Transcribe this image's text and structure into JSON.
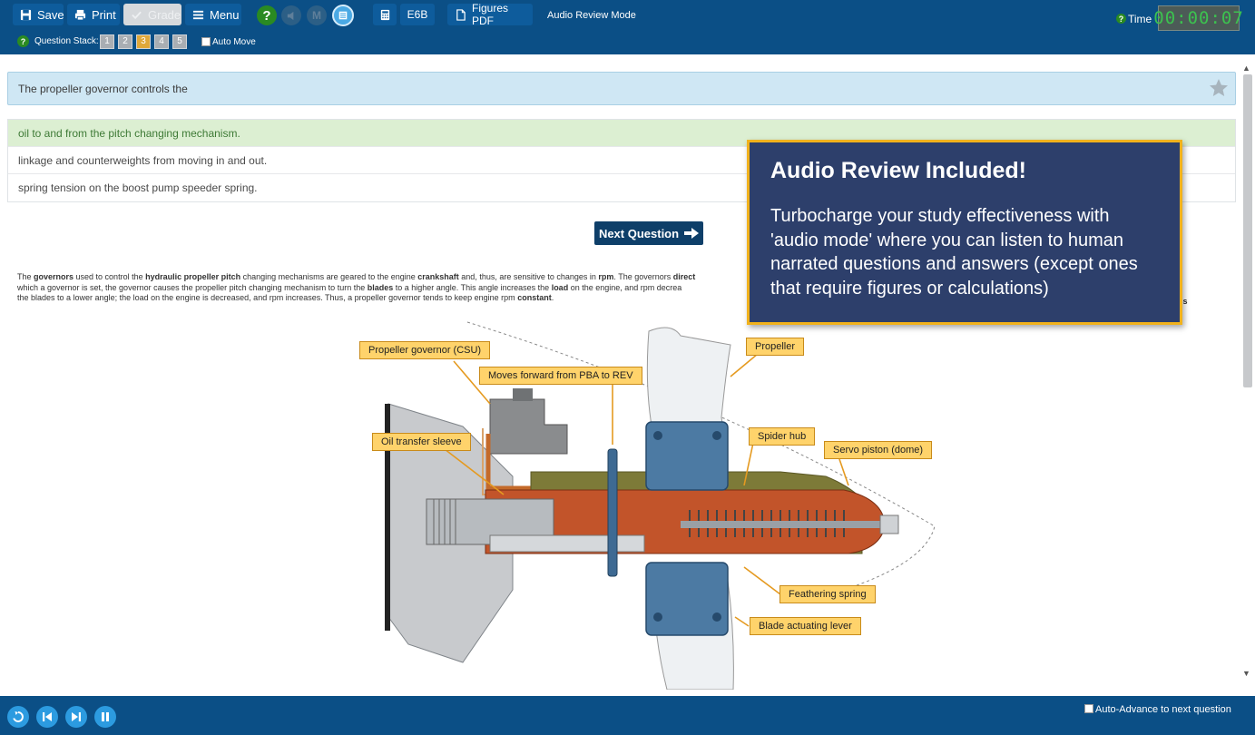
{
  "toolbar": {
    "save_label": "Save",
    "print_label": "Print",
    "grade_label": "Grade",
    "menu_label": "Menu",
    "help_glyph": "?",
    "markdown_glyph": "M",
    "code_label": "E6B",
    "figures_label": "Figures PDF",
    "mode_label": "Audio Review Mode",
    "time_label": "Time",
    "time_value": "00:00:07",
    "question_stack_label": "Question Stack:",
    "stack_items": [
      "1",
      "2",
      "3",
      "4",
      "5"
    ],
    "stack_active_index": 2,
    "auto_move_label": "Auto Move"
  },
  "question": {
    "text": "The propeller governor controls the",
    "answers": [
      "oil to and from the pitch changing mechanism.",
      "linkage and counterweights from moving in and out.",
      "spring tension on the boost pump speeder spring."
    ],
    "correct_index": 0
  },
  "next_button_label": "Next Question",
  "explanation": {
    "line1_a": "The ",
    "line1_b": "governors",
    "line1_c": " used to control the ",
    "line1_d": "hydraulic propeller pitch",
    "line1_e": " changing mechanisms are geared to the engine ",
    "line1_f": "crankshaft",
    "line1_g": " and, thus, are sensitive to changes in ",
    "line1_h": "rpm",
    "line1_i": ". The governors ",
    "line1_j": "direct",
    "line2_a": "which a governor is set, the governor causes the propeller pitch changing mechanism to turn the ",
    "line2_b": "blades",
    "line2_c": " to a higher angle. This angle increases the ",
    "line2_d": "load",
    "line2_e": " on the engine, and rpm decrea",
    "line3_a": "the blades to a lower angle; the load on the engine is decreased, and rpm increases. Thus, a propeller governor tends to keep engine rpm ",
    "line3_b": "constant",
    "line3_c": ".",
    "trailing": "is"
  },
  "figure_labels": {
    "governor": "Propeller governor (CSU)",
    "moves_forward": "Moves forward from PBA to REV",
    "oil_sleeve": "Oil transfer sleeve",
    "propeller": "Propeller",
    "spider_hub": "Spider hub",
    "servo_piston": "Servo piston (dome)",
    "feathering_spring": "Feathering spring",
    "blade_lever": "Blade actuating lever"
  },
  "promo": {
    "title": "Audio Review Included!",
    "body": "Turbocharge your study effectiveness with 'audio mode' where you can listen to human narrated  questions and answers (except ones that require figures or calculations)"
  },
  "bottom": {
    "auto_advance_label": "Auto-Advance to next question"
  },
  "colors": {
    "toolbar_bg": "#0b4f86",
    "button_bg": "#0e5c9c",
    "help_green": "#2a8a22",
    "timer_green": "#3cc24f",
    "promo_bg": "#2d3f6b",
    "promo_border": "#f1b21c",
    "correct_bg": "#dcefd2",
    "question_bg": "#cfe7f4",
    "media_blue": "#2c9be0"
  }
}
